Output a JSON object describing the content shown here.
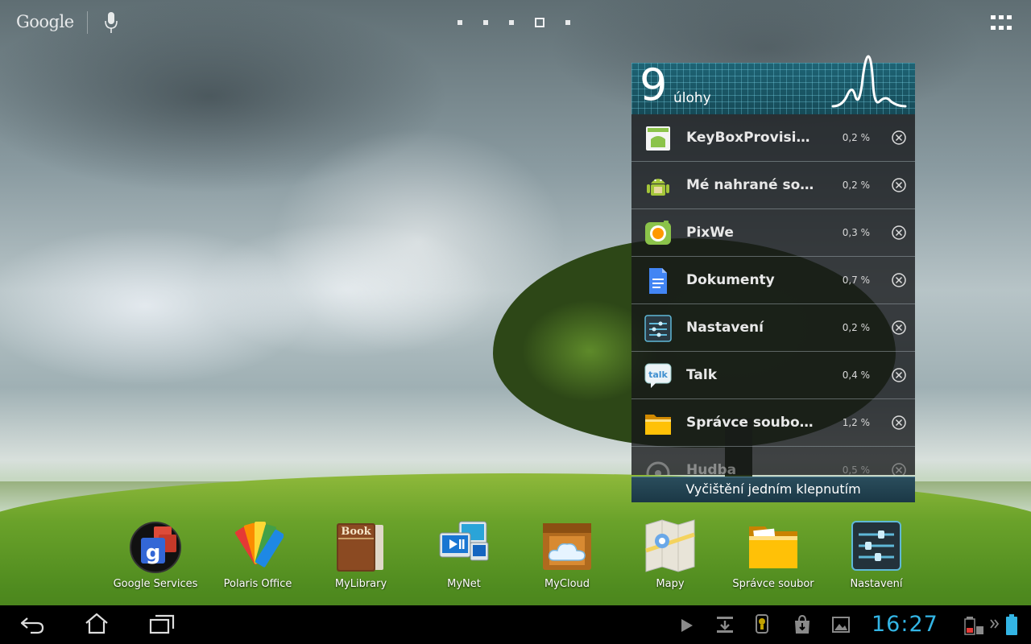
{
  "top_bar": {
    "search_logo": "Google",
    "page_count": 5,
    "current_page": 4
  },
  "task_manager": {
    "count": "9",
    "count_label": "úlohy",
    "tasks": [
      {
        "name": "KeyBoxProvision",
        "usage": "0,2 %",
        "icon": "android-package-icon"
      },
      {
        "name": "Mé nahrané soubory",
        "usage": "0,2 %",
        "icon": "android-robot-icon"
      },
      {
        "name": "PixWe",
        "usage": "0,3 %",
        "icon": "pixwe-icon"
      },
      {
        "name": "Dokumenty",
        "usage": "0,7 %",
        "icon": "docs-icon"
      },
      {
        "name": "Nastavení",
        "usage": "0,2 %",
        "icon": "settings-icon"
      },
      {
        "name": "Talk",
        "usage": "0,4 %",
        "icon": "talk-icon"
      },
      {
        "name": "Správce souborů",
        "usage": "1,2 %",
        "icon": "folder-icon"
      },
      {
        "name": "Hudba",
        "usage": "0,5 %",
        "icon": "music-icon"
      }
    ],
    "clear_label": "Vyčištění jedním klepnutím"
  },
  "dock": {
    "items": [
      {
        "label": "Google Services",
        "icon": "google-services-icon"
      },
      {
        "label": "Polaris Office",
        "icon": "polaris-office-icon"
      },
      {
        "label": "MyLibrary",
        "icon": "book-icon"
      },
      {
        "label": "MyNet",
        "icon": "mynet-icon"
      },
      {
        "label": "MyCloud",
        "icon": "cloud-icon"
      },
      {
        "label": "Mapy",
        "icon": "maps-icon"
      },
      {
        "label": "Správce soubor",
        "icon": "folder-icon"
      },
      {
        "label": "Nastavení",
        "icon": "settings-icon"
      }
    ],
    "book_icon_text": "Book"
  },
  "system_bar": {
    "clock": "16:27",
    "accent_color": "#33b5e5"
  }
}
